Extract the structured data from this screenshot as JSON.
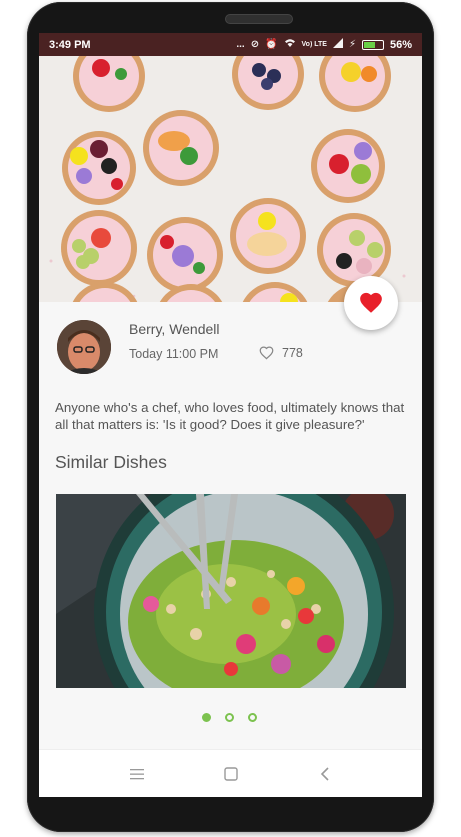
{
  "status_bar": {
    "time": "3:49 PM",
    "dots": "...",
    "network_label": "Vo) LTE",
    "battery_percent": "56%",
    "battery_level": 0.56
  },
  "post": {
    "author": "Berry, Wendell",
    "time": "Today 11:00 PM",
    "likes": "778",
    "quote": "Anyone who's a chef, who loves food, ultimately knows that all that matters is: 'Is it good? Does it give pleasure?'"
  },
  "similar": {
    "title": "Similar Dishes",
    "page_count": 3,
    "active_page": 1
  },
  "colors": {
    "accent": "#7cc24f",
    "heart": "#e8202a",
    "status_bar": "#4a2222"
  },
  "icons": {
    "fab": "heart-icon",
    "likes": "heart-outline-icon",
    "nav": [
      "menu-icon",
      "home-icon",
      "back-icon"
    ]
  }
}
